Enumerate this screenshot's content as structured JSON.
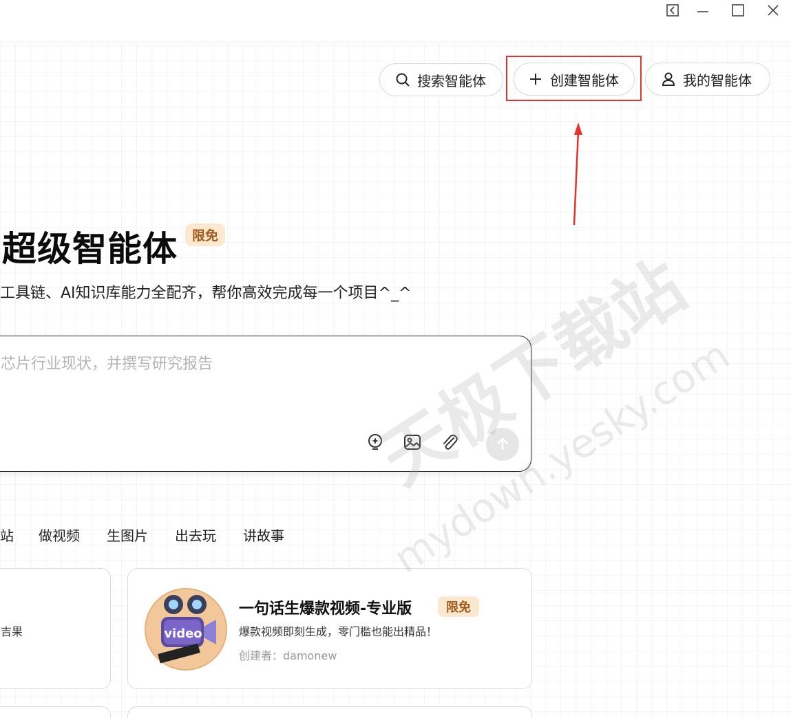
{
  "header": {
    "buttons": {
      "search": "搜索智能体",
      "create": "创建智能体",
      "mine": "我的智能体"
    }
  },
  "hero": {
    "title": "超级智能体",
    "badge": "限免",
    "subtitle": "工具链、AI知识库能力全配齐，帮你高效完成每一个项目^_^"
  },
  "input": {
    "placeholder": "芯片行业现状，并撰写研究报告"
  },
  "categories": [
    "站",
    "做视频",
    "生图片",
    "出去玩",
    "讲故事"
  ],
  "cards": [
    {
      "partial_desc": "吉果"
    },
    {
      "title": "一句话生爆款视频-专业版",
      "badge": "限免",
      "desc": "爆款视频即刻生成，零门槛也能出精品！",
      "author": "创建者：damonew",
      "avatar_text": "video"
    }
  ],
  "watermark": {
    "cn": "天极下载站",
    "en": "mydown.yesky.com"
  },
  "colors": {
    "highlight": "#e5322d",
    "badge_bg": "#fbe8cf",
    "badge_text": "#a05a1b"
  }
}
